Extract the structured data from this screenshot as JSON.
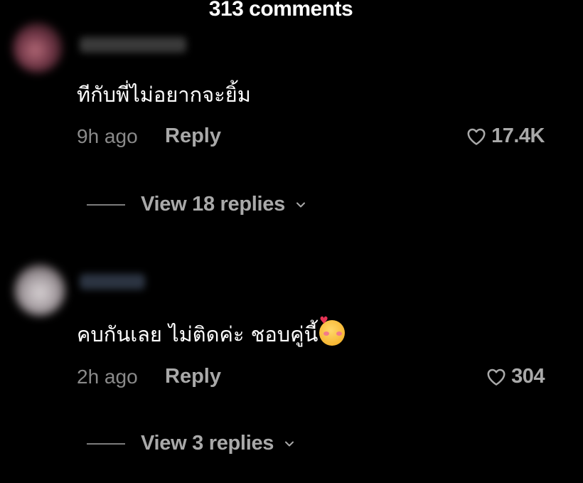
{
  "header": {
    "title": "313 comments"
  },
  "comments": [
    {
      "text": "ทีกับพี่ไม่อยากจะยิ้ม",
      "time": "9h ago",
      "reply_label": "Reply",
      "likes": "17.4K",
      "view_replies_label": "View 18 replies",
      "emoji": ""
    },
    {
      "text": "คบกันเลย ไม่ติดค่ะ ชอบคู่นี้",
      "time": "2h ago",
      "reply_label": "Reply",
      "likes": "304",
      "view_replies_label": "View 3 replies",
      "emoji": "smiling-face-with-hearts"
    }
  ],
  "icons": {
    "like": "heart-outline-icon",
    "expand": "chevron-down-icon"
  },
  "colors": {
    "background": "#000000",
    "primary_text": "#ffffff",
    "secondary_text": "#8a8a8a",
    "action_text": "#a9a9a9"
  }
}
